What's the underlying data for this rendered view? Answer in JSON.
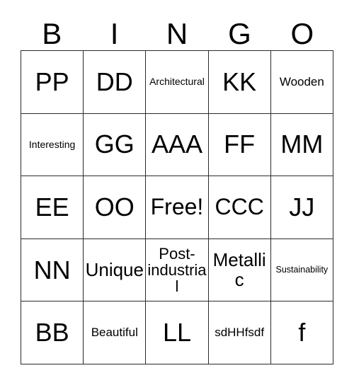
{
  "card": {
    "header_letters": [
      "B",
      "I",
      "N",
      "G",
      "O"
    ],
    "rows": [
      [
        {
          "text": "PP",
          "size": "sz-xl"
        },
        {
          "text": "DD",
          "size": "sz-xl"
        },
        {
          "text": "Architectural",
          "size": "sz-xs"
        },
        {
          "text": "KK",
          "size": "sz-xl"
        },
        {
          "text": "Wooden",
          "size": "sz-sm"
        }
      ],
      [
        {
          "text": "Interesting",
          "size": "sz-xs"
        },
        {
          "text": "GG",
          "size": "sz-xl"
        },
        {
          "text": "AAA",
          "size": "sz-xl"
        },
        {
          "text": "FF",
          "size": "sz-xl"
        },
        {
          "text": "MM",
          "size": "sz-xl"
        }
      ],
      [
        {
          "text": "EE",
          "size": "sz-xl"
        },
        {
          "text": "OO",
          "size": "sz-xl"
        },
        {
          "text": "Free!",
          "size": "sz-lg"
        },
        {
          "text": "CCC",
          "size": "sz-lg"
        },
        {
          "text": "JJ",
          "size": "sz-xl"
        }
      ],
      [
        {
          "text": "NN",
          "size": "sz-xl"
        },
        {
          "text": "Unique",
          "size": "sz-md"
        },
        {
          "text": "Post-industrial",
          "size": "sz-mdw"
        },
        {
          "text": "Metallic",
          "size": "sz-md"
        },
        {
          "text": "Sustainability",
          "size": "sz-xxs"
        }
      ],
      [
        {
          "text": "BB",
          "size": "sz-xl"
        },
        {
          "text": "Beautiful",
          "size": "sz-sm"
        },
        {
          "text": "LL",
          "size": "sz-xl"
        },
        {
          "text": "sdHHfsdf",
          "size": "sz-sm"
        },
        {
          "text": "f",
          "size": "sz-xl"
        }
      ]
    ],
    "colors": {
      "background": "#ffffff",
      "border": "#2b2b2b",
      "text": "#000000"
    }
  }
}
